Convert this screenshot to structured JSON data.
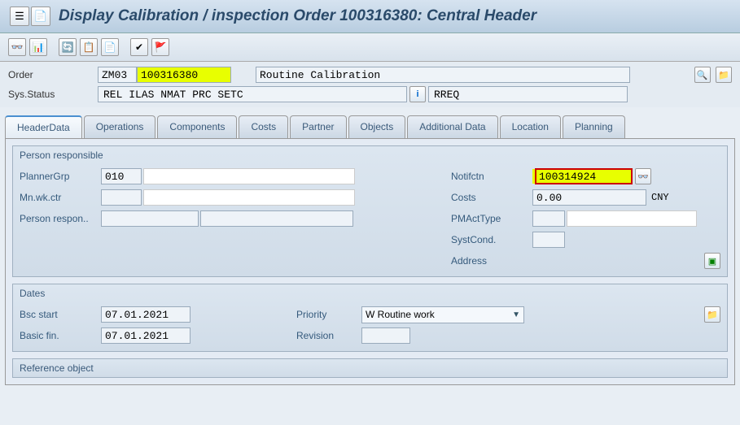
{
  "page_title": "Display Calibration / inspection Order 100316380: Central Header",
  "header": {
    "order_label": "Order",
    "order_type": "ZM03",
    "order_number": "100316380",
    "order_desc": "Routine Calibration",
    "status_label": "Sys.Status",
    "status1": "REL  ILAS NMAT PRC  SETC",
    "status2": "RREQ"
  },
  "tabs": {
    "headerdata": "HeaderData",
    "operations": "Operations",
    "components": "Components",
    "costs": "Costs",
    "partner": "Partner",
    "objects": "Objects",
    "additional": "Additional Data",
    "location": "Location",
    "planning": "Planning"
  },
  "person_resp": {
    "group_title": "Person responsible",
    "plannergrp_label": "PlannerGrp",
    "plannergrp_value": "010",
    "mnwkctr_label": "Mn.wk.ctr",
    "mnwkctr_value": "",
    "personresp_label": "Person respon..",
    "personresp_value": "",
    "notif_label": "Notifctn",
    "notif_value": "100314924",
    "costs_label": "Costs",
    "costs_value": "0.00",
    "costs_currency": "CNY",
    "pmact_label": "PMActType",
    "pmact_value": "",
    "systcond_label": "SystCond.",
    "systcond_value": "",
    "address_label": "Address"
  },
  "dates": {
    "group_title": "Dates",
    "bscstart_label": "Bsc start",
    "bscstart_value": "07.01.2021",
    "basicfin_label": "Basic fin.",
    "basicfin_value": "07.01.2021",
    "priority_label": "Priority",
    "priority_value": "W Routine work",
    "revision_label": "Revision",
    "revision_value": ""
  },
  "ref_object": {
    "group_title": "Reference object"
  }
}
